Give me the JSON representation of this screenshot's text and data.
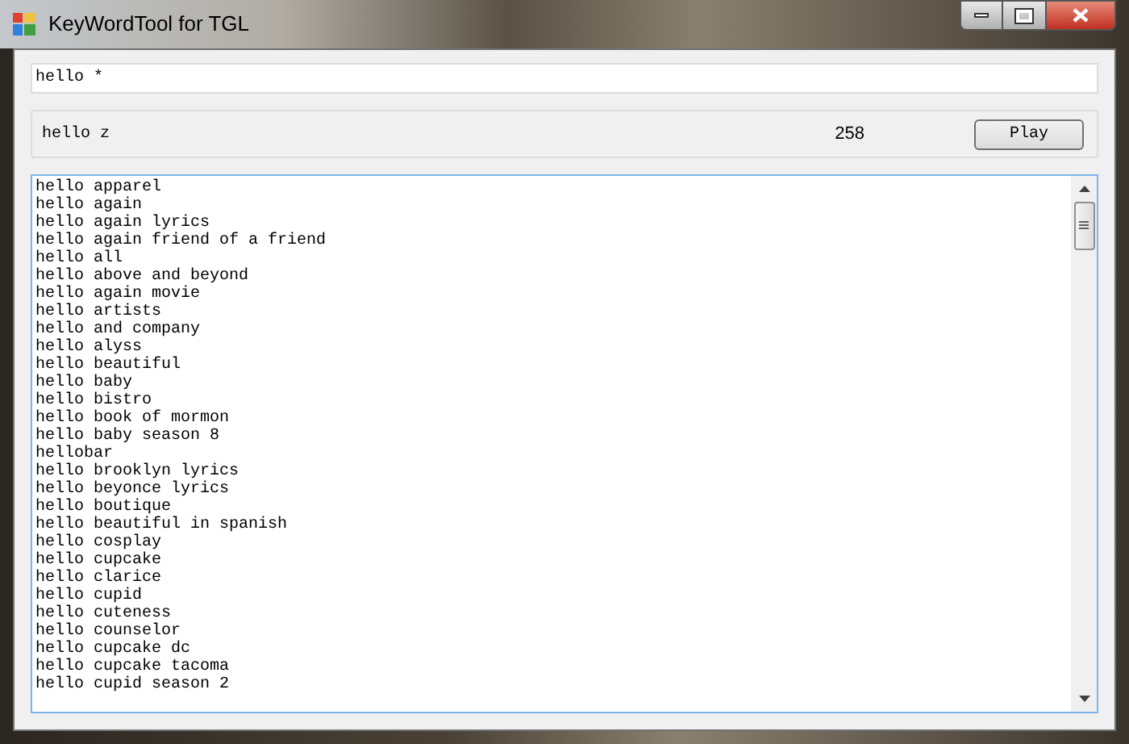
{
  "window": {
    "title": "KeyWordTool for TGL"
  },
  "search": {
    "value": "hello *"
  },
  "current": {
    "keyword": "hello z",
    "count": "258",
    "button": "Play"
  },
  "results": [
    "hello apparel",
    "hello again",
    "hello again lyrics",
    "hello again friend of a friend",
    "hello all",
    "hello above and beyond",
    "hello again movie",
    "hello artists",
    "hello and company",
    "hello alyss",
    "hello beautiful",
    "hello baby",
    "hello bistro",
    "hello book of mormon",
    "hello baby season 8",
    "hellobar",
    "hello brooklyn lyrics",
    "hello beyonce lyrics",
    "hello boutique",
    "hello beautiful in spanish",
    "hello cosplay",
    "hello cupcake",
    "hello clarice",
    "hello cupid",
    "hello cuteness",
    "hello counselor",
    "hello cupcake dc",
    "hello cupcake tacoma",
    "hello cupid season 2"
  ]
}
